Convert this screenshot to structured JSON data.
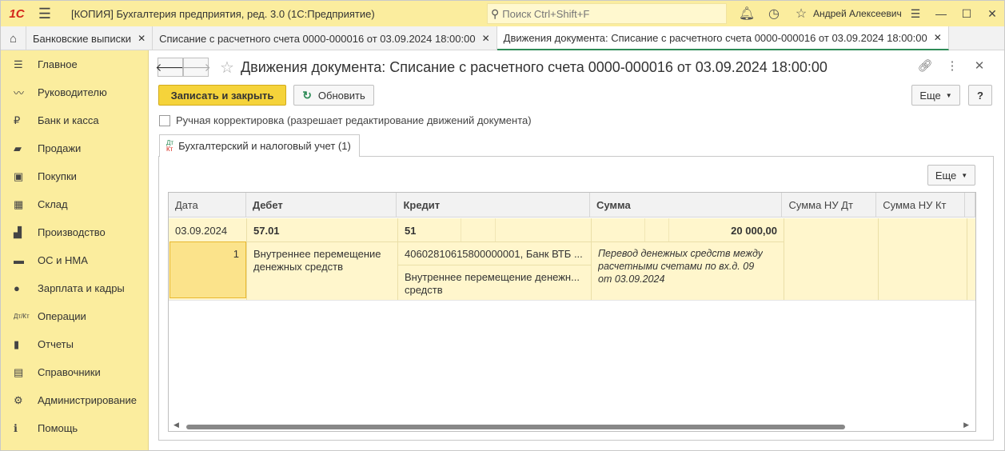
{
  "titlebar": {
    "logo": "1С",
    "title": "[КОПИЯ] Бухгалтерия предприятия, ред. 3.0  (1С:Предприятие)",
    "search_placeholder": "Поиск Ctrl+Shift+F",
    "user": "Андрей Алексеевич",
    "icons": [
      "bell-icon",
      "history-icon",
      "star-icon"
    ]
  },
  "tabs": [
    {
      "label": "Банковские выписки"
    },
    {
      "label": "Списание с расчетного счета 0000-000016 от 03.09.2024 18:00:00"
    },
    {
      "label": "Движения документа: Списание с расчетного счета 0000-000016 от 03.09.2024 18:00:00"
    }
  ],
  "sidebar": {
    "items": [
      {
        "label": "Главное",
        "icon": "menu-icon"
      },
      {
        "label": "Руководителю",
        "icon": "chart-line-icon"
      },
      {
        "label": "Банк и касса",
        "icon": "ruble-icon"
      },
      {
        "label": "Продажи",
        "icon": "bag-icon"
      },
      {
        "label": "Покупки",
        "icon": "cart-icon"
      },
      {
        "label": "Склад",
        "icon": "warehouse-icon"
      },
      {
        "label": "Производство",
        "icon": "factory-icon"
      },
      {
        "label": "ОС и НМА",
        "icon": "truck-icon"
      },
      {
        "label": "Зарплата и кадры",
        "icon": "person-icon"
      },
      {
        "label": "Операции",
        "icon": "dt-kt-icon"
      },
      {
        "label": "Отчеты",
        "icon": "bar-chart-icon"
      },
      {
        "label": "Справочники",
        "icon": "books-icon"
      },
      {
        "label": "Администрирование",
        "icon": "gear-icon"
      },
      {
        "label": "Помощь",
        "icon": "help-icon"
      }
    ]
  },
  "main": {
    "title": "Движения документа: Списание с расчетного счета 0000-000016 от 03.09.2024 18:00:00",
    "save_close": "Записать и закрыть",
    "refresh": "Обновить",
    "more": "Еще",
    "help": "?",
    "manual_edit": "Ручная корректировка (разрешает редактирование движений документа)",
    "panel_tab": "Бухгалтерский и налоговый учет (1)",
    "panel_tab_icon": {
      "top": "Дт",
      "bottom": "Кт"
    },
    "panel_more": "Еще"
  },
  "grid": {
    "columns": [
      "Дата",
      "Дебет",
      "Кредит",
      "Сумма",
      "Сумма НУ Дт",
      "Сумма НУ Кт"
    ],
    "row": {
      "date": "03.09.2024",
      "number": "1",
      "debit_account": "57.01",
      "debit_sub1_line1": "Внутреннее перемещение",
      "debit_sub1_line2": "денежных средств",
      "credit_account": "51",
      "credit_sub1": "40602810615800000001, Банк ВТБ ...",
      "credit_sub2_line1": "Внутреннее перемещение денежн...",
      "credit_sub2_line2": "средств",
      "amount": "20 000,00",
      "content_line1": "Перевод денежных средств между",
      "content_line2": "расчетными счетами по вх.д. 09",
      "content_line3": "от 03.09.2024"
    }
  },
  "colors": {
    "accent": "#f5d33a",
    "panel": "#fbed9e",
    "green": "#2e8b57",
    "brand": "#d4261b"
  }
}
